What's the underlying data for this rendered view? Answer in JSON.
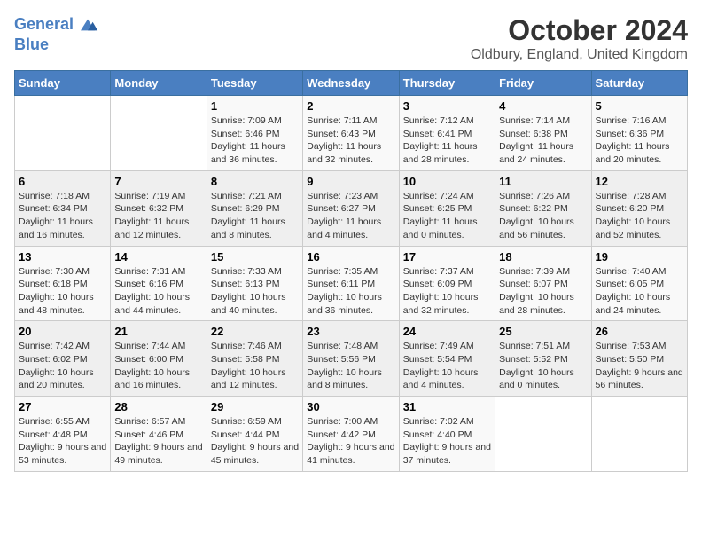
{
  "header": {
    "logo_line1": "General",
    "logo_line2": "Blue",
    "month_title": "October 2024",
    "location": "Oldbury, England, United Kingdom"
  },
  "weekdays": [
    "Sunday",
    "Monday",
    "Tuesday",
    "Wednesday",
    "Thursday",
    "Friday",
    "Saturday"
  ],
  "weeks": [
    [
      {
        "day": "",
        "info": ""
      },
      {
        "day": "",
        "info": ""
      },
      {
        "day": "1",
        "info": "Sunrise: 7:09 AM\nSunset: 6:46 PM\nDaylight: 11 hours and 36 minutes."
      },
      {
        "day": "2",
        "info": "Sunrise: 7:11 AM\nSunset: 6:43 PM\nDaylight: 11 hours and 32 minutes."
      },
      {
        "day": "3",
        "info": "Sunrise: 7:12 AM\nSunset: 6:41 PM\nDaylight: 11 hours and 28 minutes."
      },
      {
        "day": "4",
        "info": "Sunrise: 7:14 AM\nSunset: 6:38 PM\nDaylight: 11 hours and 24 minutes."
      },
      {
        "day": "5",
        "info": "Sunrise: 7:16 AM\nSunset: 6:36 PM\nDaylight: 11 hours and 20 minutes."
      }
    ],
    [
      {
        "day": "6",
        "info": "Sunrise: 7:18 AM\nSunset: 6:34 PM\nDaylight: 11 hours and 16 minutes."
      },
      {
        "day": "7",
        "info": "Sunrise: 7:19 AM\nSunset: 6:32 PM\nDaylight: 11 hours and 12 minutes."
      },
      {
        "day": "8",
        "info": "Sunrise: 7:21 AM\nSunset: 6:29 PM\nDaylight: 11 hours and 8 minutes."
      },
      {
        "day": "9",
        "info": "Sunrise: 7:23 AM\nSunset: 6:27 PM\nDaylight: 11 hours and 4 minutes."
      },
      {
        "day": "10",
        "info": "Sunrise: 7:24 AM\nSunset: 6:25 PM\nDaylight: 11 hours and 0 minutes."
      },
      {
        "day": "11",
        "info": "Sunrise: 7:26 AM\nSunset: 6:22 PM\nDaylight: 10 hours and 56 minutes."
      },
      {
        "day": "12",
        "info": "Sunrise: 7:28 AM\nSunset: 6:20 PM\nDaylight: 10 hours and 52 minutes."
      }
    ],
    [
      {
        "day": "13",
        "info": "Sunrise: 7:30 AM\nSunset: 6:18 PM\nDaylight: 10 hours and 48 minutes."
      },
      {
        "day": "14",
        "info": "Sunrise: 7:31 AM\nSunset: 6:16 PM\nDaylight: 10 hours and 44 minutes."
      },
      {
        "day": "15",
        "info": "Sunrise: 7:33 AM\nSunset: 6:13 PM\nDaylight: 10 hours and 40 minutes."
      },
      {
        "day": "16",
        "info": "Sunrise: 7:35 AM\nSunset: 6:11 PM\nDaylight: 10 hours and 36 minutes."
      },
      {
        "day": "17",
        "info": "Sunrise: 7:37 AM\nSunset: 6:09 PM\nDaylight: 10 hours and 32 minutes."
      },
      {
        "day": "18",
        "info": "Sunrise: 7:39 AM\nSunset: 6:07 PM\nDaylight: 10 hours and 28 minutes."
      },
      {
        "day": "19",
        "info": "Sunrise: 7:40 AM\nSunset: 6:05 PM\nDaylight: 10 hours and 24 minutes."
      }
    ],
    [
      {
        "day": "20",
        "info": "Sunrise: 7:42 AM\nSunset: 6:02 PM\nDaylight: 10 hours and 20 minutes."
      },
      {
        "day": "21",
        "info": "Sunrise: 7:44 AM\nSunset: 6:00 PM\nDaylight: 10 hours and 16 minutes."
      },
      {
        "day": "22",
        "info": "Sunrise: 7:46 AM\nSunset: 5:58 PM\nDaylight: 10 hours and 12 minutes."
      },
      {
        "day": "23",
        "info": "Sunrise: 7:48 AM\nSunset: 5:56 PM\nDaylight: 10 hours and 8 minutes."
      },
      {
        "day": "24",
        "info": "Sunrise: 7:49 AM\nSunset: 5:54 PM\nDaylight: 10 hours and 4 minutes."
      },
      {
        "day": "25",
        "info": "Sunrise: 7:51 AM\nSunset: 5:52 PM\nDaylight: 10 hours and 0 minutes."
      },
      {
        "day": "26",
        "info": "Sunrise: 7:53 AM\nSunset: 5:50 PM\nDaylight: 9 hours and 56 minutes."
      }
    ],
    [
      {
        "day": "27",
        "info": "Sunrise: 6:55 AM\nSunset: 4:48 PM\nDaylight: 9 hours and 53 minutes."
      },
      {
        "day": "28",
        "info": "Sunrise: 6:57 AM\nSunset: 4:46 PM\nDaylight: 9 hours and 49 minutes."
      },
      {
        "day": "29",
        "info": "Sunrise: 6:59 AM\nSunset: 4:44 PM\nDaylight: 9 hours and 45 minutes."
      },
      {
        "day": "30",
        "info": "Sunrise: 7:00 AM\nSunset: 4:42 PM\nDaylight: 9 hours and 41 minutes."
      },
      {
        "day": "31",
        "info": "Sunrise: 7:02 AM\nSunset: 4:40 PM\nDaylight: 9 hours and 37 minutes."
      },
      {
        "day": "",
        "info": ""
      },
      {
        "day": "",
        "info": ""
      }
    ]
  ]
}
